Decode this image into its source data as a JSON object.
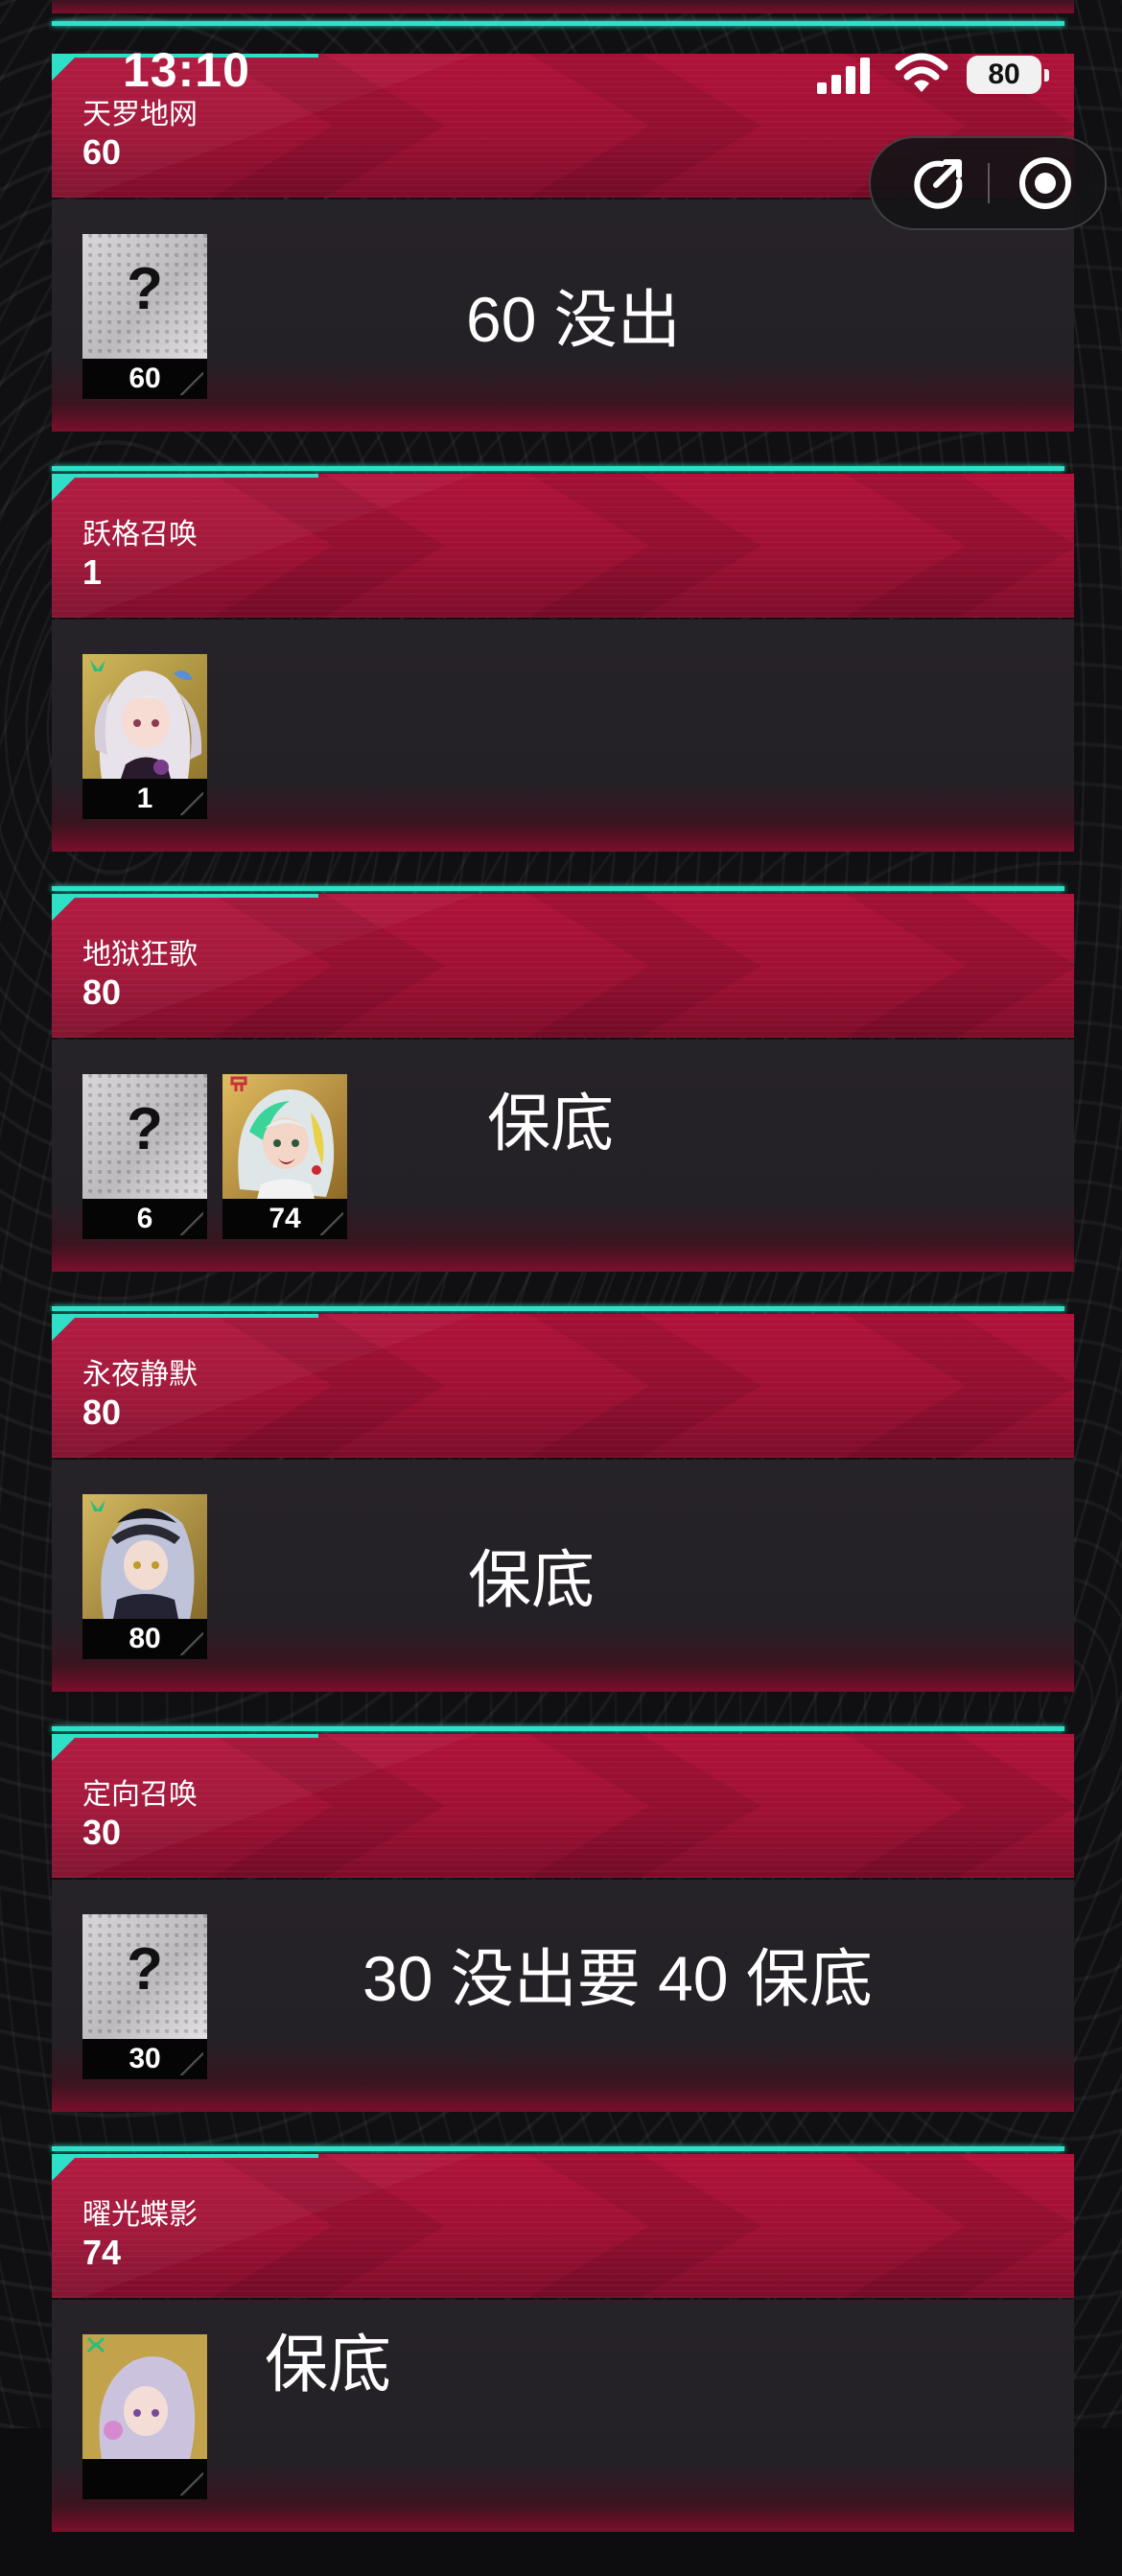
{
  "status_bar": {
    "time": "13:10",
    "battery": "80"
  },
  "capsule": {
    "share_icon": "share-icon",
    "close_icon": "target-close-icon"
  },
  "colors": {
    "header_red": "#a8113a",
    "teal_accent": "#2fe0c8",
    "body_dark": "#252227"
  },
  "cards": [
    {
      "title": "天罗地网",
      "count": "60",
      "note": "60 没出",
      "items": [
        {
          "type": "unknown",
          "num": "60"
        }
      ]
    },
    {
      "title": "跃格召唤",
      "count": "1",
      "note": "",
      "items": [
        {
          "type": "avatar",
          "num": "1"
        }
      ]
    },
    {
      "title": "地狱狂歌",
      "count": "80",
      "note": "保底",
      "items": [
        {
          "type": "unknown",
          "num": "6"
        },
        {
          "type": "avatar",
          "num": "74"
        }
      ]
    },
    {
      "title": "永夜静默",
      "count": "80",
      "note": "保底",
      "items": [
        {
          "type": "avatar",
          "num": "80"
        }
      ]
    },
    {
      "title": "定向召唤",
      "count": "30",
      "note": "30 没出要 40 保底",
      "items": [
        {
          "type": "unknown",
          "num": "30"
        }
      ]
    },
    {
      "title": "曜光蝶影",
      "count": "74",
      "note": "保底",
      "items": [
        {
          "type": "avatar",
          "num": ""
        }
      ]
    }
  ]
}
